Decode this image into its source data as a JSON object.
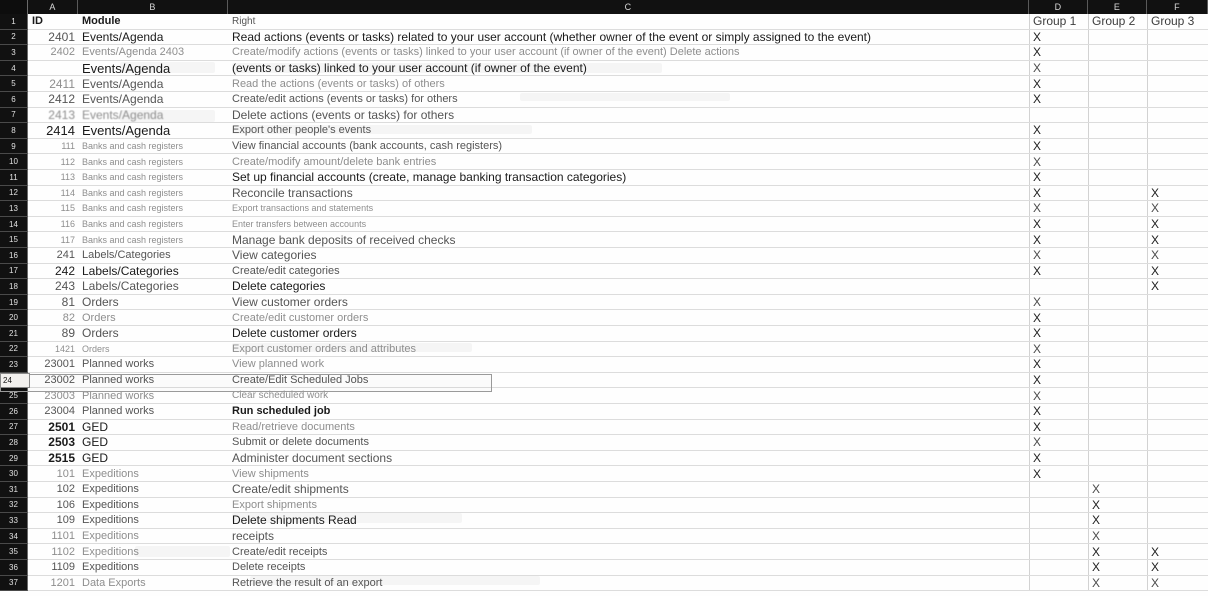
{
  "column_headers": [
    "",
    "A",
    "B",
    "C",
    "D",
    "E",
    "F"
  ],
  "header_row": {
    "id": "ID",
    "module": "Module",
    "right": "Right",
    "group1": "Group 1",
    "group2": "Group 2",
    "group3": "Group 3"
  },
  "selected_row_number": "24",
  "rows": [
    {
      "n": "1",
      "id": "ID",
      "module": "Module",
      "right": "Right",
      "g1": "Group 1",
      "g2": "Group 2",
      "g3": "Group 3"
    },
    {
      "n": "2",
      "id": "2401",
      "module": "Events/Agenda",
      "right": "Read actions (events or tasks) related to your user account (whether owner of the event or simply assigned to the event)",
      "g1": "X",
      "g2": "",
      "g3": ""
    },
    {
      "n": "3",
      "id": "2402",
      "module": "Events/Agenda 2403",
      "right": "Create/modify actions (events or tasks) linked to your user account (if owner of the event) Delete actions",
      "g1": "X",
      "g2": "",
      "g3": ""
    },
    {
      "n": "4",
      "id": "",
      "module": "Events/Agenda",
      "right": "(events or tasks) linked to your user account (if owner of the event)",
      "g1": "X",
      "g2": "",
      "g3": ""
    },
    {
      "n": "5",
      "id": "2411",
      "module": "Events/Agenda",
      "right": "Read the actions (events or tasks) of others",
      "g1": "X",
      "g2": "",
      "g3": ""
    },
    {
      "n": "6",
      "id": "2412",
      "module": "Events/Agenda",
      "right": "Create/edit actions (events or tasks) for others",
      "g1": "X",
      "g2": "",
      "g3": ""
    },
    {
      "n": "7",
      "id": "2413",
      "module": "Events/Agenda",
      "right": "Delete actions (events or tasks) for others",
      "g1": "",
      "g2": "",
      "g3": ""
    },
    {
      "n": "8",
      "id": "2414",
      "module": "Events/Agenda",
      "right": "Export other people's events",
      "g1": "X",
      "g2": "",
      "g3": ""
    },
    {
      "n": "9",
      "id": "111",
      "module": "Banks and cash registers",
      "right": "View financial accounts (bank accounts, cash registers)",
      "g1": "X",
      "g2": "",
      "g3": ""
    },
    {
      "n": "10",
      "id": "112",
      "module": "Banks and cash registers",
      "right": "Create/modify amount/delete bank entries",
      "g1": "X",
      "g2": "",
      "g3": ""
    },
    {
      "n": "11",
      "id": "113",
      "module": "Banks and cash registers",
      "right": "Set up financial accounts (create, manage banking transaction categories)",
      "g1": "X",
      "g2": "",
      "g3": ""
    },
    {
      "n": "12",
      "id": "114",
      "module": "Banks and cash registers",
      "right": "Reconcile transactions",
      "g1": "X",
      "g2": "",
      "g3": "X"
    },
    {
      "n": "13",
      "id": "115",
      "module": "Banks and cash registers",
      "right": "Export transactions and statements",
      "g1": "X",
      "g2": "",
      "g3": "X"
    },
    {
      "n": "14",
      "id": "116",
      "module": "Banks and cash registers",
      "right": "Enter transfers between accounts",
      "g1": "X",
      "g2": "",
      "g3": "X"
    },
    {
      "n": "15",
      "id": "117",
      "module": "Banks and cash registers",
      "right": "Manage bank deposits of received checks",
      "g1": "X",
      "g2": "",
      "g3": "X"
    },
    {
      "n": "16",
      "id": "241",
      "module": "Labels/Categories",
      "right": "View categories",
      "g1": "X",
      "g2": "",
      "g3": "X"
    },
    {
      "n": "17",
      "id": "242",
      "module": "Labels/Categories",
      "right": "Create/edit categories",
      "g1": "X",
      "g2": "",
      "g3": "X"
    },
    {
      "n": "18",
      "id": "243",
      "module": "Labels/Categories",
      "right": "Delete categories",
      "g1": "",
      "g2": "",
      "g3": "X"
    },
    {
      "n": "19",
      "id": "81",
      "module": "Orders",
      "right": "View customer orders",
      "g1": "X",
      "g2": "",
      "g3": ""
    },
    {
      "n": "20",
      "id": "82",
      "module": "Orders",
      "right": "Create/edit customer orders",
      "g1": "X",
      "g2": "",
      "g3": ""
    },
    {
      "n": "21",
      "id": "89",
      "module": "Orders",
      "right": "Delete customer orders",
      "g1": "X",
      "g2": "",
      "g3": ""
    },
    {
      "n": "22",
      "id": "1421",
      "module": "Orders",
      "right": "Export customer orders and attributes",
      "g1": "X",
      "g2": "",
      "g3": ""
    },
    {
      "n": "23",
      "id": "23001",
      "module": "Planned works",
      "right": "View planned work",
      "g1": "X",
      "g2": "",
      "g3": ""
    },
    {
      "n": "24",
      "id": "23002",
      "module": "Planned works",
      "right": "Create/Edit Scheduled Jobs",
      "g1": "X",
      "g2": "",
      "g3": ""
    },
    {
      "n": "25",
      "id": "23003",
      "module": "Planned works",
      "right": "Clear scheduled work",
      "g1": "X",
      "g2": "",
      "g3": ""
    },
    {
      "n": "26",
      "id": "23004",
      "module": "Planned works",
      "right": "Run scheduled job",
      "g1": "X",
      "g2": "",
      "g3": ""
    },
    {
      "n": "27",
      "id": "2501",
      "module": "GED",
      "right": "Read/retrieve documents",
      "g1": "X",
      "g2": "",
      "g3": ""
    },
    {
      "n": "28",
      "id": "2503",
      "module": "GED",
      "right": "Submit or delete documents",
      "g1": "X",
      "g2": "",
      "g3": ""
    },
    {
      "n": "29",
      "id": "2515",
      "module": "GED",
      "right": "Administer document sections",
      "g1": "X",
      "g2": "",
      "g3": ""
    },
    {
      "n": "30",
      "id": "101",
      "module": "Expeditions",
      "right": "View shipments",
      "g1": "X",
      "g2": "",
      "g3": ""
    },
    {
      "n": "31",
      "id": "102",
      "module": "Expeditions",
      "right": "Create/edit shipments",
      "g1": "",
      "g2": "X",
      "g3": ""
    },
    {
      "n": "32",
      "id": "106",
      "module": "Expeditions",
      "right": "Export shipments",
      "g1": "",
      "g2": "X",
      "g3": ""
    },
    {
      "n": "33",
      "id": "109",
      "module": "Expeditions",
      "right": "Delete shipments Read",
      "g1": "",
      "g2": "X",
      "g3": ""
    },
    {
      "n": "34",
      "id": "1101",
      "module": "Expeditions",
      "right": "receipts",
      "g1": "",
      "g2": "X",
      "g3": ""
    },
    {
      "n": "35",
      "id": "1102",
      "module": "Expeditions",
      "right": "Create/edit receipts",
      "g1": "",
      "g2": "X",
      "g3": "X"
    },
    {
      "n": "36",
      "id": "1109",
      "module": "Expeditions",
      "right": "Delete receipts",
      "g1": "",
      "g2": "X",
      "g3": "X"
    },
    {
      "n": "37",
      "id": "1201",
      "module": "Data Exports",
      "right": "Retrieve the result of an export",
      "g1": "",
      "g2": "X",
      "g3": "X"
    }
  ]
}
